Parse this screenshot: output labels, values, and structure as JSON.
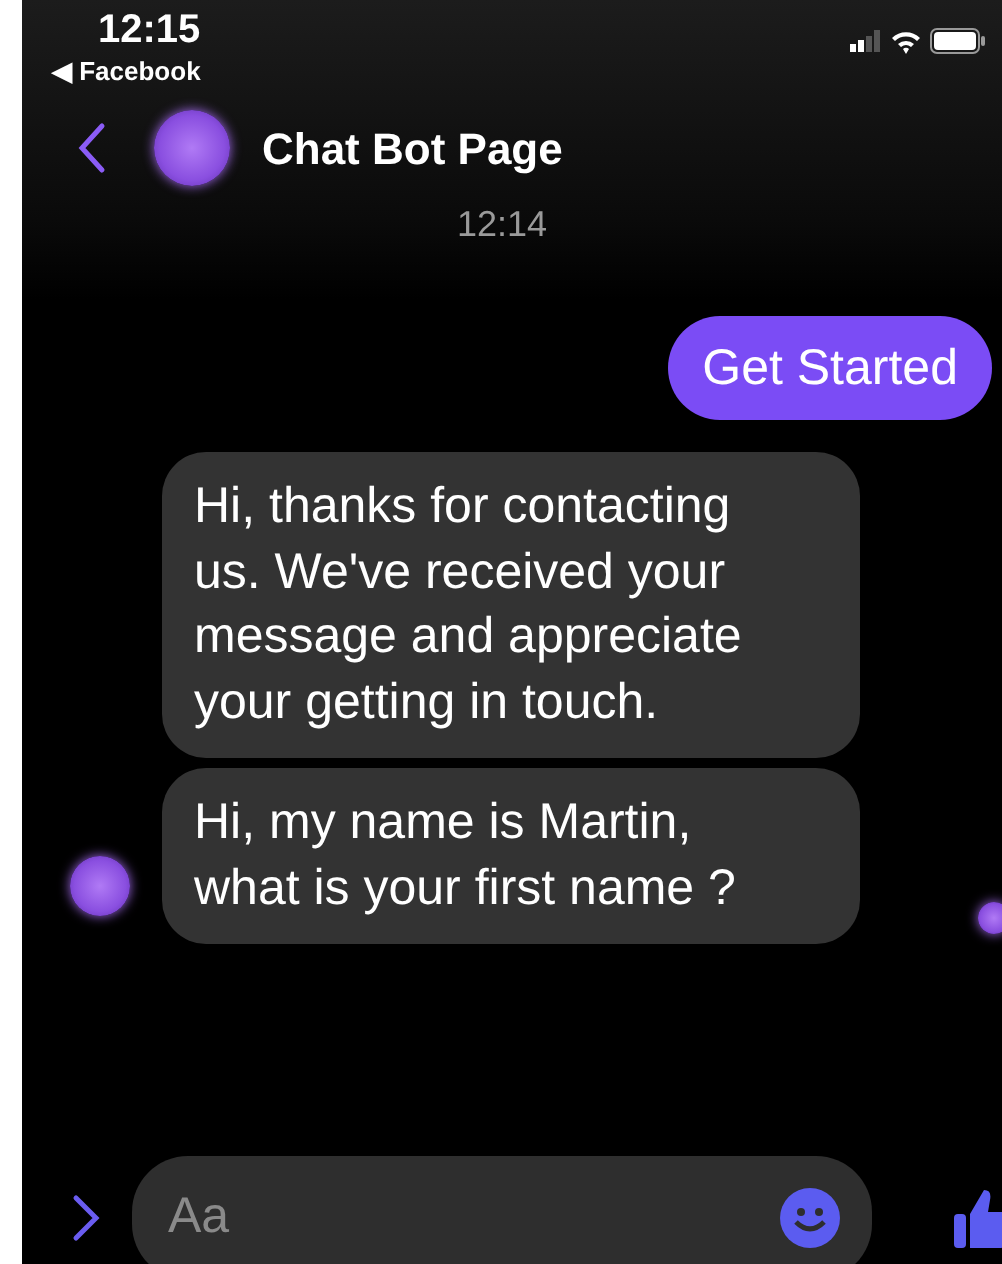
{
  "status_bar": {
    "time": "12:15",
    "back_app": "◀ Facebook"
  },
  "header": {
    "title": "Chat Bot Page"
  },
  "timestamp": "12:14",
  "messages": [
    {
      "kind": "sent",
      "text": "Get Started"
    },
    {
      "kind": "received",
      "text": "Hi, thanks for contacting us. We've received your message and appreciate your getting in touch."
    },
    {
      "kind": "received",
      "text": "Hi, my name is Martin, what is your first name ?"
    }
  ],
  "composer": {
    "placeholder": "Aa"
  }
}
